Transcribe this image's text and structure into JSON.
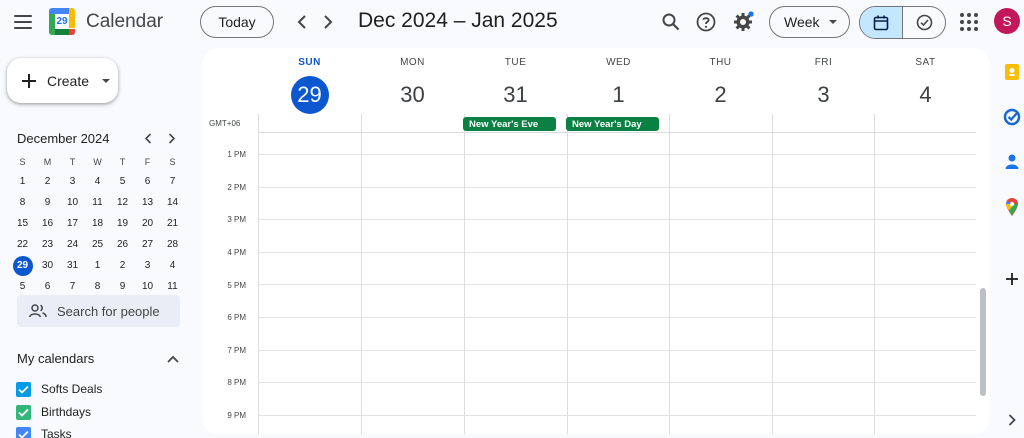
{
  "header": {
    "app_title": "Calendar",
    "logo_number": "29",
    "today_label": "Today",
    "date_range": "Dec 2024 – Jan 2025",
    "view_label": "Week",
    "avatar_letter": "S"
  },
  "sidebar": {
    "create_label": "Create",
    "mini_calendar": {
      "month_label": "December 2024",
      "weekdays": [
        "S",
        "M",
        "T",
        "W",
        "T",
        "F",
        "S"
      ],
      "weeks": [
        [
          "1",
          "2",
          "3",
          "4",
          "5",
          "6",
          "7"
        ],
        [
          "8",
          "9",
          "10",
          "11",
          "12",
          "13",
          "14"
        ],
        [
          "15",
          "16",
          "17",
          "18",
          "19",
          "20",
          "21"
        ],
        [
          "22",
          "23",
          "24",
          "25",
          "26",
          "27",
          "28"
        ],
        [
          "29",
          "30",
          "31",
          "1",
          "2",
          "3",
          "4"
        ],
        [
          "5",
          "6",
          "7",
          "8",
          "9",
          "10",
          "11"
        ]
      ]
    },
    "search_people_label": "Search for people",
    "my_calendars": {
      "title": "My calendars",
      "items": [
        {
          "label": "Softs Deals",
          "color": "#039be5"
        },
        {
          "label": "Birthdays",
          "color": "#33b679"
        },
        {
          "label": "Tasks",
          "color": "#4285f4"
        }
      ]
    }
  },
  "grid": {
    "timezone": "GMT+06",
    "days": [
      {
        "dow": "SUN",
        "num": "29"
      },
      {
        "dow": "MON",
        "num": "30"
      },
      {
        "dow": "TUE",
        "num": "31"
      },
      {
        "dow": "WED",
        "num": "1"
      },
      {
        "dow": "THU",
        "num": "2"
      },
      {
        "dow": "FRI",
        "num": "3"
      },
      {
        "dow": "SAT",
        "num": "4"
      }
    ],
    "hours": [
      "1 PM",
      "2 PM",
      "3 PM",
      "4 PM",
      "5 PM",
      "6 PM",
      "7 PM",
      "8 PM",
      "9 PM"
    ],
    "all_day_events": [
      {
        "title": "New Year's Eve",
        "color": "#0b8043"
      },
      {
        "title": "New Year's Day",
        "color": "#0b8043"
      }
    ]
  },
  "colors": {
    "accent": "#0b57d0",
    "avatar": "#c2185b",
    "holiday": "#0b8043"
  }
}
